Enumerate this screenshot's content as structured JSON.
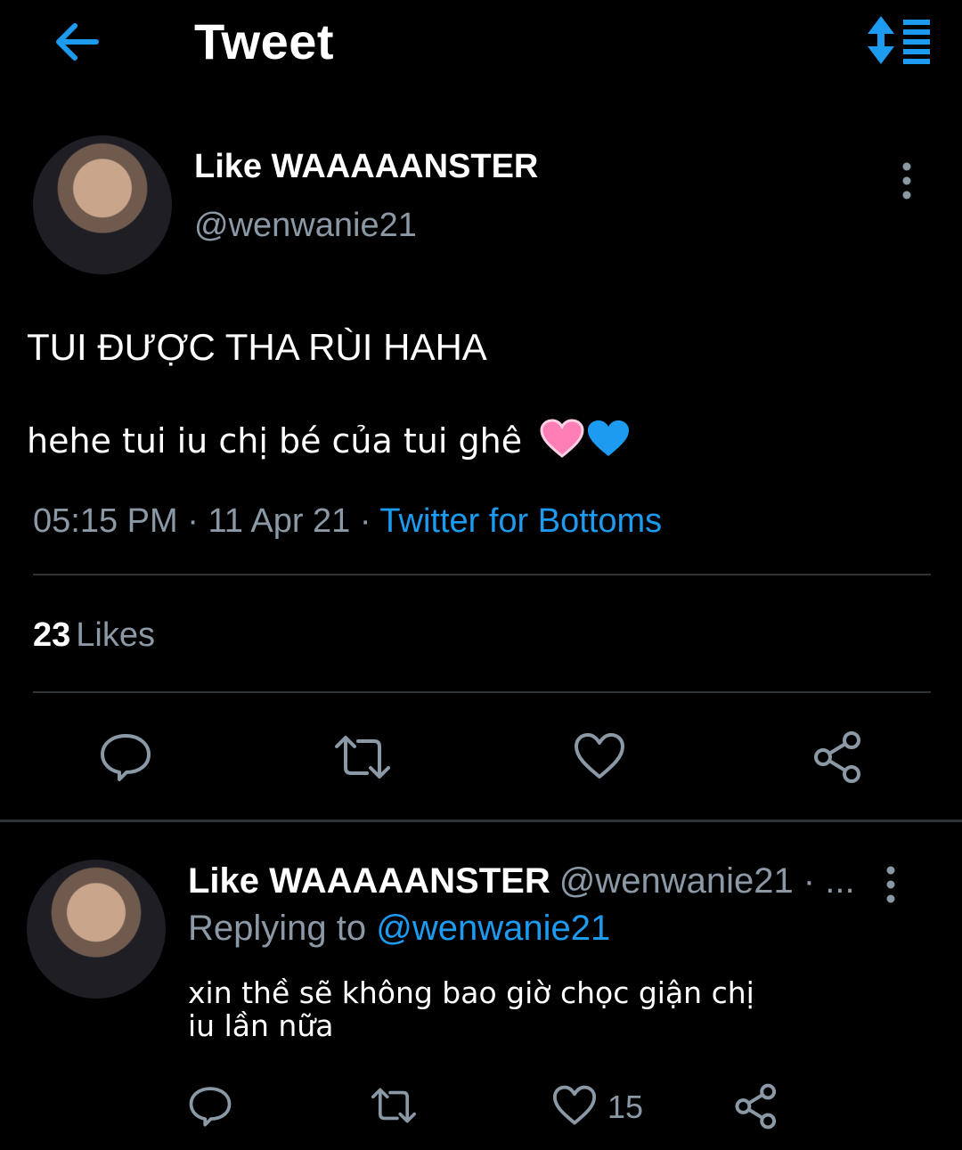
{
  "header": {
    "title": "Tweet",
    "back_icon": "arrow-left-icon",
    "sort_icon": "sort-icon"
  },
  "colors": {
    "accent": "#1d9bf0",
    "muted": "#8b98a5",
    "background": "#000000",
    "divider": "#2f3336",
    "pink_heart": "#ff7eb6",
    "blue_heart": "#1d9bf0"
  },
  "tweet": {
    "author_name": "Like WAAAAANSTER",
    "handle": "@wenwanie21",
    "text_line1": "TUI ĐƯỢC THA RÙI HAHA",
    "text_line2": "hehe tui iu chị bé của tui ghê",
    "emojis": [
      "pink-heart",
      "blue-heart"
    ],
    "time": "05:15 PM",
    "sep1": " · ",
    "date": "11 Apr 21",
    "sep2": " · ",
    "source": "Twitter for Bottoms",
    "likes_count": "23",
    "likes_label": "Likes"
  },
  "reply": {
    "author_name": "Like WAAAAANSTER",
    "handle_trunc": "@wenwanie21 · ...",
    "replying_prefix": "Replying to ",
    "replying_to": "@wenwanie21",
    "text": "xin thề sẽ không bao giờ chọc giận chị iu lần nữa",
    "like_count": "15"
  }
}
